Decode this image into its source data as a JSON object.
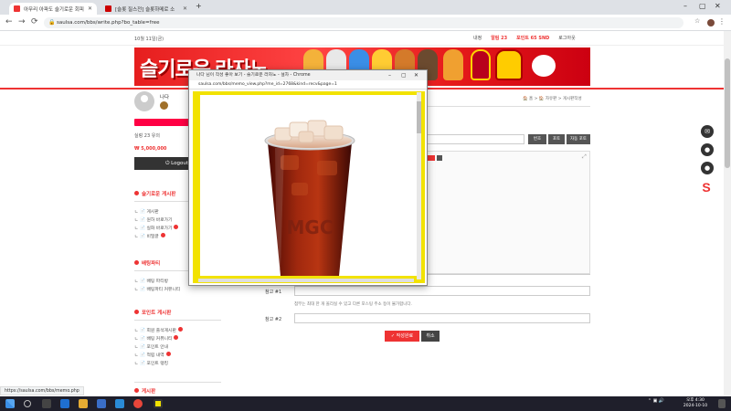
{
  "browser": {
    "tabs": [
      {
        "label": "아무리 아파도 슬기로운 회피",
        "active": true
      },
      {
        "label": "[슬롯 질스전] 슬롯하메로 소",
        "active": false
      }
    ],
    "new_tab": "+",
    "window_controls": [
      "–",
      "▢",
      "✕"
    ],
    "url": "saulsa.com/bbs/write.php?bo_table=free"
  },
  "site": {
    "top_left": "10월 11일(금)",
    "top_right": [
      "내정",
      "알림 23",
      "포인트 65 SND",
      "로그아웃"
    ],
    "banner_title": "슬기로운 라자노",
    "breadcrumb": "🏠 홈 > 🏠 자유판 > 게시판작성"
  },
  "sidebar": {
    "username": "나다",
    "stats": "실렁 23     유의",
    "money": "₩ 5,000,000",
    "logout": "⏻ Logout",
    "sections": [
      {
        "title": "슬기로운 게시판",
        "items": [
          "게시판",
          "원하 바로가기",
          "실화 바로가기",
          "비밀글"
        ]
      },
      {
        "title": "배팅파티",
        "items": [
          "배팅 파티방",
          "배팅파티 커뮤니티"
        ]
      },
      {
        "title": "포인트 게시판",
        "items": [
          "회원 출석게시판",
          "배팅 커뮤니티",
          "포인트 안내",
          "적립 내역",
          "포인트 랭킹"
        ]
      },
      {
        "title": "게시판",
        "items": []
      }
    ]
  },
  "form": {
    "toolbar_buttons": [
      "번호",
      "포토",
      "자동 포토"
    ],
    "label_link": "참고 #1",
    "hint_link": "첨부는 최대 한 개 올리실 수 있고 다른 포스팅 주소 등이 불가합니다.",
    "label_link2": "참고 #2",
    "submit": "✓ 작성완료",
    "cancel": "취소"
  },
  "popup": {
    "title": "나다 님이 작성 좋아 보기 - 슬기로운 라자노 - 설차 - Chrome",
    "url": "saulsa.com/bbs/memo_view.php?me_id=2768&kind=recv&page=1",
    "image_alt": "iced-coffee-cup",
    "cup_logo": "MGC"
  },
  "statusbar": {
    "text": "https://saulsa.com/bbs/memo.php"
  },
  "taskbar": {
    "time": "오후 4:30",
    "date": "2024-10-10"
  },
  "colors": {
    "brand_red": "#e33333",
    "popup_frame": "#f2e200",
    "taskbar": "#1f1f2b"
  }
}
